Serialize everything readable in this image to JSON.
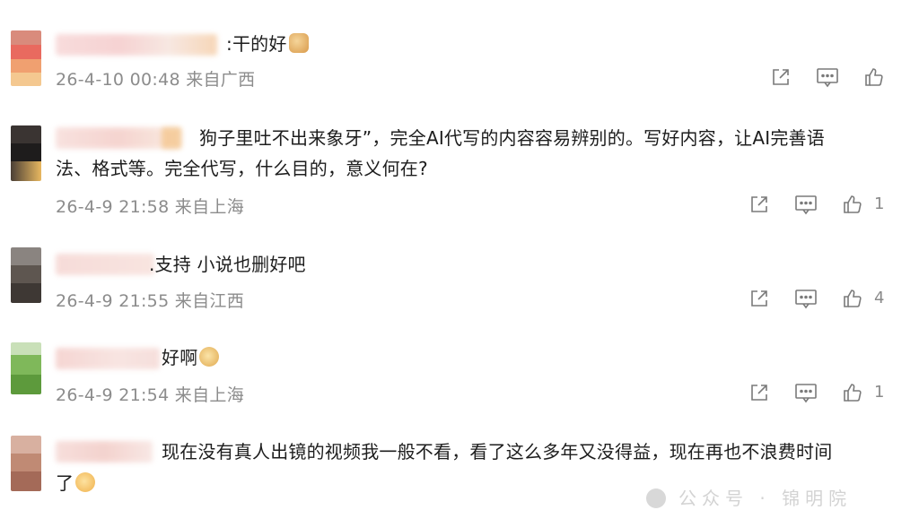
{
  "comments": [
    {
      "text": ":干的好",
      "meta": "26-4-10 00:48 来自广西",
      "likes": ""
    },
    {
      "text_line1": "狗子里吐不出来象牙”，完全AI代写的内容容易辨别的。写好内容，让AI完善语",
      "text_line2": "法、格式等。完全代写，什么目的，意义何在?",
      "meta": "26-4-9 21:58 来自上海",
      "likes": "1"
    },
    {
      "text": ".支持 小说也删好吧",
      "meta": "26-4-9 21:55 来自江西",
      "likes": "4"
    },
    {
      "text": "好啊",
      "meta": "26-4-9 21:54 来自上海",
      "likes": "1"
    },
    {
      "text_line1": "现在没有真人出镜的视频我一般不看，看了这么多年又没得益，现在再也不浪费时间",
      "text_line2": "了"
    }
  ],
  "icons": {
    "share": "share-icon",
    "reply": "comment-icon",
    "like": "thumbs-up-icon"
  },
  "colors": {
    "meta_text": "#8c8c8c",
    "body_text": "#1d1d1d",
    "icon": "#7a7a7a"
  }
}
